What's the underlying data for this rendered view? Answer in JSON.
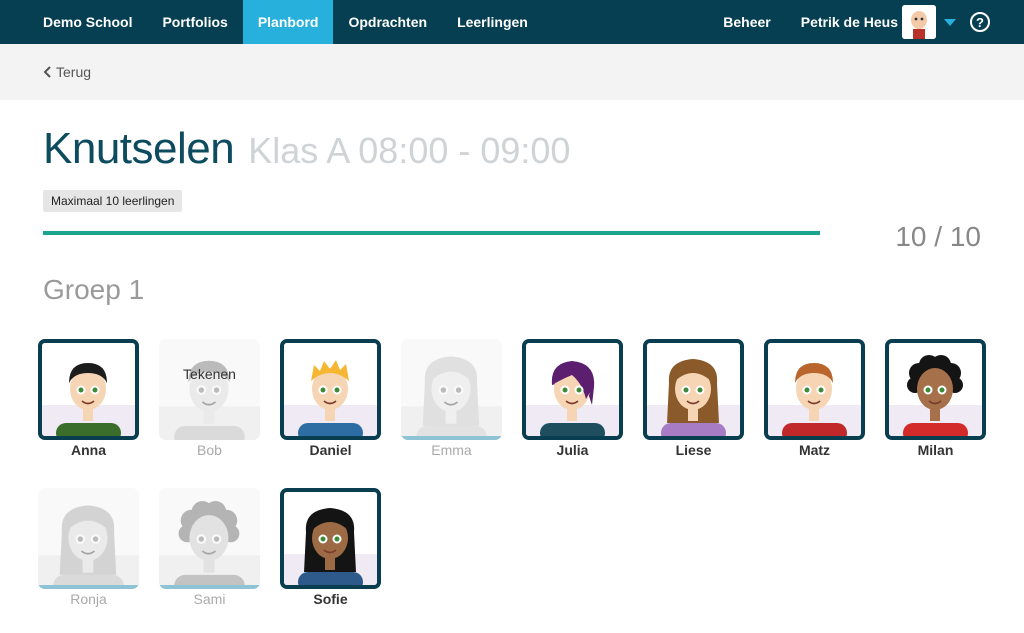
{
  "nav": {
    "items": [
      {
        "label": "Demo School",
        "active": false
      },
      {
        "label": "Portfolios",
        "active": false
      },
      {
        "label": "Planbord",
        "active": true
      },
      {
        "label": "Opdrachten",
        "active": false
      },
      {
        "label": "Leerlingen",
        "active": false
      }
    ],
    "admin_label": "Beheer",
    "user_name": "Petrik de Heus",
    "help_symbol": "?"
  },
  "back_label": "Terug",
  "activity": {
    "title": "Knutselen",
    "subtitle": "Klas A 08:00 - 09:00",
    "max_badge": "Maximaal 10 leerlingen",
    "progress_fraction": 1.0,
    "count_text": "10 / 10"
  },
  "group_title": "Groep 1",
  "students": [
    {
      "name": "Anna",
      "selected": true,
      "hair": "#1c1c1c",
      "skin": "#f6d5b5",
      "shirt": "#3b6e2a",
      "style": "short"
    },
    {
      "name": "Bob",
      "selected": false,
      "note": "Tekenen",
      "hair": "#777777",
      "skin": "#dddddd",
      "shirt": "#bbbbbb",
      "style": "short"
    },
    {
      "name": "Daniel",
      "selected": true,
      "hair": "#f5b731",
      "skin": "#f6d5b5",
      "shirt": "#2e6da4",
      "style": "spiky"
    },
    {
      "name": "Emma",
      "selected": false,
      "hair": "#c8c8c8",
      "skin": "#e8e8e8",
      "shirt": "#cccccc",
      "style": "long",
      "bar": true
    },
    {
      "name": "Julia",
      "selected": true,
      "hair": "#5c1e6e",
      "skin": "#f6d5b5",
      "shirt": "#1f4e5f",
      "style": "side"
    },
    {
      "name": "Liese",
      "selected": true,
      "hair": "#8b5a2b",
      "skin": "#f6d5b5",
      "shirt": "#a77cc4",
      "style": "long"
    },
    {
      "name": "Matz",
      "selected": true,
      "hair": "#b9652c",
      "skin": "#f6d5b5",
      "shirt": "#c0282a",
      "style": "short"
    },
    {
      "name": "Milan",
      "selected": true,
      "hair": "#141414",
      "skin": "#a6714a",
      "shirt": "#d32a2a",
      "style": "curly"
    },
    {
      "name": "Ronja",
      "selected": false,
      "hair": "#aaaaaa",
      "skin": "#dddddd",
      "shirt": "#bbbbbb",
      "style": "long",
      "bar": true
    },
    {
      "name": "Sami",
      "selected": false,
      "hair": "#666666",
      "skin": "#cccccc",
      "shirt": "#888888",
      "style": "curly",
      "bar": true
    },
    {
      "name": "Sofie",
      "selected": true,
      "hair": "#141414",
      "skin": "#9c6a45",
      "shirt": "#2d5a8a",
      "style": "long"
    }
  ]
}
